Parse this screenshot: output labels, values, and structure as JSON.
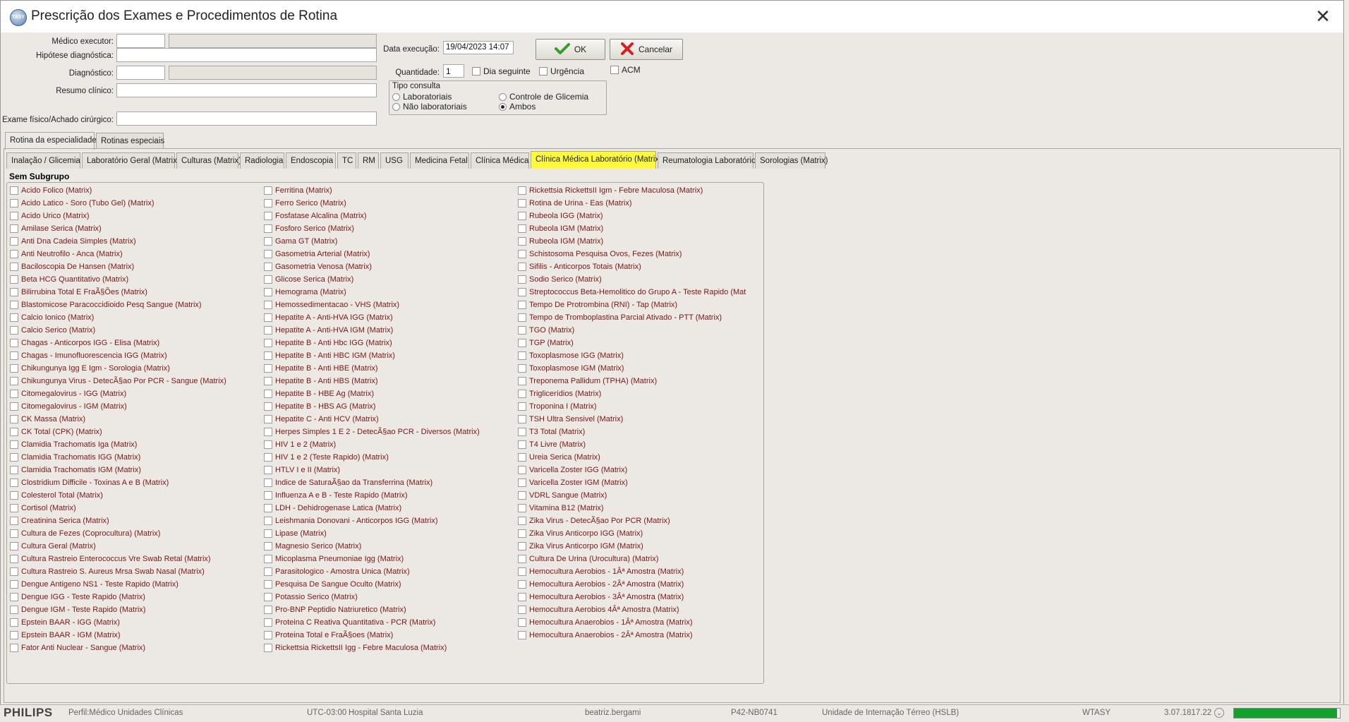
{
  "window": {
    "title": "Prescrição dos Exames e Procedimentos de Rotina",
    "icon_text": "TASY"
  },
  "form": {
    "medico_executor_label": "Médico executor:",
    "hipotese_label": "Hipótese diagnóstica:",
    "diagnostico_label": "Diagnóstico:",
    "resumo_label": "Resumo clínico:",
    "exame_fisico_label": "Exame físico/Achado cirúrgico:",
    "data_execucao_label": "Data execução:",
    "data_execucao_value": "19/04/2023 14:07",
    "quantidade_label": "Quantidade:",
    "quantidade_value": "1",
    "dia_seguinte_label": "Dia seguinte",
    "urgencia_label": "Urgência",
    "acm_label": "ACM",
    "tipo_consulta": {
      "title": "Tipo consulta",
      "options": [
        "Laboratoriais",
        "Controle de Glicemia",
        "Não laboratoriais",
        "Ambos"
      ],
      "selected": "Ambos"
    }
  },
  "buttons": {
    "ok": "OK",
    "cancelar": "Cancelar"
  },
  "outer_tabs": [
    "Rotina da especialidade",
    "Rotinas especiais"
  ],
  "inner_tabs": [
    "Inalação / Glicemia",
    "Laboratório Geral (Matrix)",
    "Culturas (Matrix)",
    "Radiologia",
    "Endoscopia",
    "TC",
    "RM",
    "USG",
    "Medicina Fetal",
    "Clínica Médica",
    "Clínica Médica Laboratório (Matrix)",
    "Reumatologia Laboratório",
    "Sorologias (Matrix)"
  ],
  "active_inner_tab": "Clínica Médica Laboratório (Matrix)",
  "subgroup_title": "Sem Subgrupo",
  "exams": {
    "col1": [
      "Acido Folico  (Matrix)",
      "Acido Latico - Soro (Tubo Gel) (Matrix)",
      "Acido Urico (Matrix)",
      "Amilase Serica (Matrix)",
      "Anti Dna Cadeia Simples (Matrix)",
      "Anti Neutrofilo - Anca (Matrix)",
      "Baciloscopia De Hansen (Matrix)",
      "Beta HCG Quantitativo (Matrix)",
      "Bilirrubina Total E FraÃ§Ões (Matrix)",
      "Blastomicose Paracoccidioido Pesq Sangue (Matrix)",
      "Calcio Ionico (Matrix)",
      "Calcio Serico (Matrix)",
      "Chagas - Anticorpos IGG - Elisa (Matrix)",
      "Chagas - Imunofluorescencia IGG (Matrix)",
      "Chikungunya Igg E Igm - Sorologia (Matrix)",
      "Chikungunya Virus - DetecÃ§ao Por PCR - Sangue (Matrix)",
      "Citomegalovirus - IGG (Matrix)",
      "Citomegalovirus - IGM (Matrix)",
      "CK Massa (Matrix)",
      "CK Total (CPK) (Matrix)",
      "Clamidia Trachomatis Iga (Matrix)",
      "Clamidia Trachomatis IGG (Matrix)",
      "Clamidia Trachomatis IGM (Matrix)",
      "Clostridium Difficile - Toxinas A e B (Matrix)",
      "Colesterol Total (Matrix)",
      "Cortisol (Matrix)",
      "Creatinina Serica (Matrix)",
      "Cultura de Fezes (Coprocultura) (Matrix)",
      "Cultura Geral (Matrix)",
      "Cultura Rastreio Enterococcus Vre Swab Retal (Matrix)",
      "Cultura Rastreio S. Aureus Mrsa Swab Nasal (Matrix)",
      "Dengue Antigeno NS1 - Teste Rapido (Matrix)",
      "Dengue IGG - Teste Rapido (Matrix)",
      "Dengue IGM - Teste Rapido (Matrix)",
      "Epstein BAAR - IGG (Matrix)",
      "Epstein BAAR - IGM (Matrix)",
      "Fator Anti Nuclear - Sangue (Matrix)"
    ],
    "col2": [
      "Ferritina (Matrix)",
      "Ferro Serico (Matrix)",
      "Fosfatase Alcalina (Matrix)",
      "Fosforo Serico (Matrix)",
      "Gama GT (Matrix)",
      "Gasometria Arterial (Matrix)",
      "Gasometria Venosa (Matrix)",
      "Glicose Serica (Matrix)",
      "Hemograma (Matrix)",
      "Hemossedimentacao - VHS (Matrix)",
      "Hepatite A - Anti-HVA IGG (Matrix)",
      "Hepatite A - Anti-HVA IGM (Matrix)",
      "Hepatite B - Anti Hbc IGG (Matrix)",
      "Hepatite B - Anti HBC IGM (Matrix)",
      "Hepatite B - Anti HBE (Matrix)",
      "Hepatite B - Anti HBS (Matrix)",
      "Hepatite B - HBE Ag (Matrix)",
      "Hepatite B - HBS AG (Matrix)",
      "Hepatite C - Anti HCV (Matrix)",
      "Herpes Simples 1 E 2 - DetecÃ§ao PCR - Diversos (Matrix)",
      "HIV 1 e 2 (Matrix)",
      "HIV 1 e 2 (Teste Rapido) (Matrix)",
      "HTLV I e II (Matrix)",
      "Indice de SaturaÃ§ao da Transferrina (Matrix)",
      "Influenza A e B - Teste Rapido (Matrix)",
      "LDH - Dehidrogenase Latica (Matrix)",
      "Leishmania Donovani - Anticorpos IGG (Matrix)",
      "Lipase (Matrix)",
      "Magnesio Serico (Matrix)",
      "Micoplasma Pneumoniae Igg (Matrix)",
      "Parasitologico - Amostra Unica (Matrix)",
      "Pesquisa De Sangue Oculto (Matrix)",
      "Potassio Serico (Matrix)",
      "Pro-BNP Peptidio Natriuretico (Matrix)",
      "Proteina C Reativa Quantitativa - PCR (Matrix)",
      "Proteina Total e FraÃ§oes (Matrix)",
      "Rickettsia RickettsII Igg - Febre Maculosa (Matrix)"
    ],
    "col3": [
      "Rickettsia RickettsII Igm - Febre Maculosa (Matrix)",
      "Rotina de Urina  - Eas (Matrix)",
      "Rubeola IGG (Matrix)",
      "Rubeola IGM (Matrix)",
      "Rubeola IGM (Matrix)",
      "Schistosoma Pesquisa Ovos, Fezes (Matrix)",
      "Sifilis - Anticorpos Totais (Matrix)",
      "Sodio Serico (Matrix)",
      "Streptococcus Beta-Hemolitico do Grupo A - Teste Rapido (Mat",
      "Tempo De Protrombina (RNI) - Tap (Matrix)",
      "Tempo de Tromboplastina Parcial Ativado - PTT (Matrix)",
      "TGO (Matrix)",
      "TGP (Matrix)",
      "Toxoplasmose IGG (Matrix)",
      "Toxoplasmose IGM (Matrix)",
      "Treponema Pallidum (TPHA) (Matrix)",
      "Triglicerídios (Matrix)",
      "Troponina I (Matrix)",
      "TSH Ultra Sensivel (Matrix)",
      "T3 Total (Matrix)",
      "T4 Livre (Matrix)",
      "Ureia Serica (Matrix)",
      "Varicella Zoster IGG (Matrix)",
      "Varicella Zoster IGM (Matrix)",
      "VDRL Sangue (Matrix)",
      "Vitamina B12 (Matrix)",
      "Zika Virus - DetecÃ§ao Por PCR (Matrix)",
      "Zika Virus Anticorpo IGG (Matrix)",
      "Zika Virus Anticorpo IGM (Matrix)",
      "Cultura De Urina (Urocultura) (Matrix)",
      "Hemocultura Aerobios - 1Âª Amostra (Matrix)",
      "Hemocultura Aerobios - 2Âª Amostra (Matrix)",
      "Hemocultura Aerobios - 3Âª Amostra (Matrix)",
      "Hemocultura Aerobios 4Âª Amostra (Matrix)",
      "Hemocultura Anaerobios - 1Âª Amostra (Matrix)",
      "Hemocultura Anaerobios - 2Âª Amostra (Matrix)"
    ]
  },
  "status": {
    "brand": "PHILIPS",
    "perfil": "Perfil:Médico Unidades Clínicas",
    "timezone": "UTC-03:00",
    "hospital": "Hospital Santa Luzia",
    "user": "beatriz.bergami",
    "machine": "P42-NB0741",
    "unit": "Unidade de Internação Térreo (HSLB)",
    "db": "WTASY",
    "version": "3.07.1817.22",
    "progress": 0.97
  },
  "colors": {
    "tab_highlight": "#fff93a",
    "exam_text": "#7a1515",
    "progress": "#12a12a"
  }
}
